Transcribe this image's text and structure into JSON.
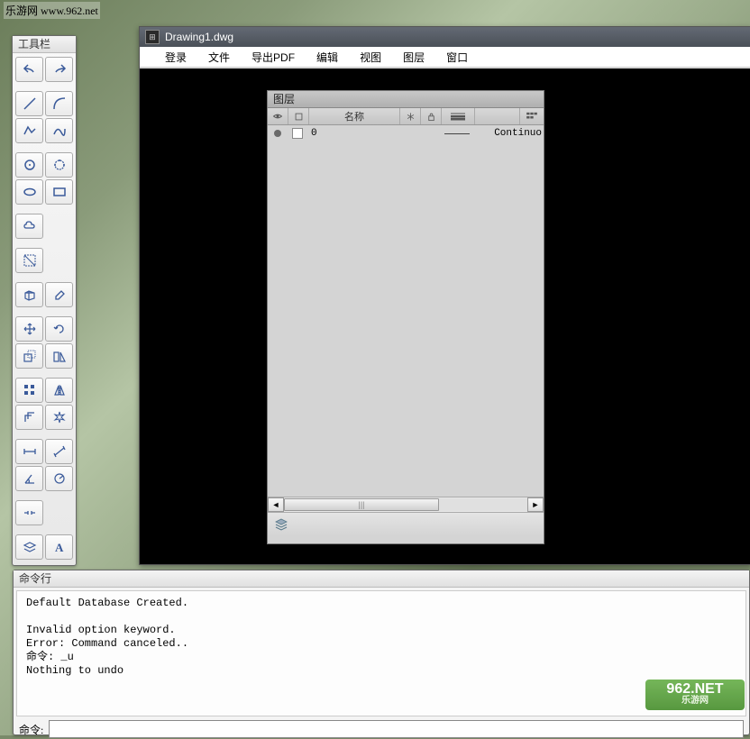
{
  "watermark": "乐游网 www.962.net",
  "tool_palette": {
    "title": "工具栏"
  },
  "app": {
    "title": "Drawing1.dwg",
    "menu": [
      "登录",
      "文件",
      "导出PDF",
      "编辑",
      "视图",
      "图层",
      "窗口"
    ]
  },
  "layer_panel": {
    "title": "图层",
    "header_name": "名称",
    "row": {
      "name": "0",
      "linetype": "Continuo"
    }
  },
  "cmd": {
    "title": "命令行",
    "lines": "Default Database Created.\n\nInvalid option keyword.\nError: Command canceled..\n命令: _u\nNothing to undo",
    "prompt": "命令:"
  },
  "logo": {
    "big": "962.NET",
    "small": "乐游网"
  }
}
